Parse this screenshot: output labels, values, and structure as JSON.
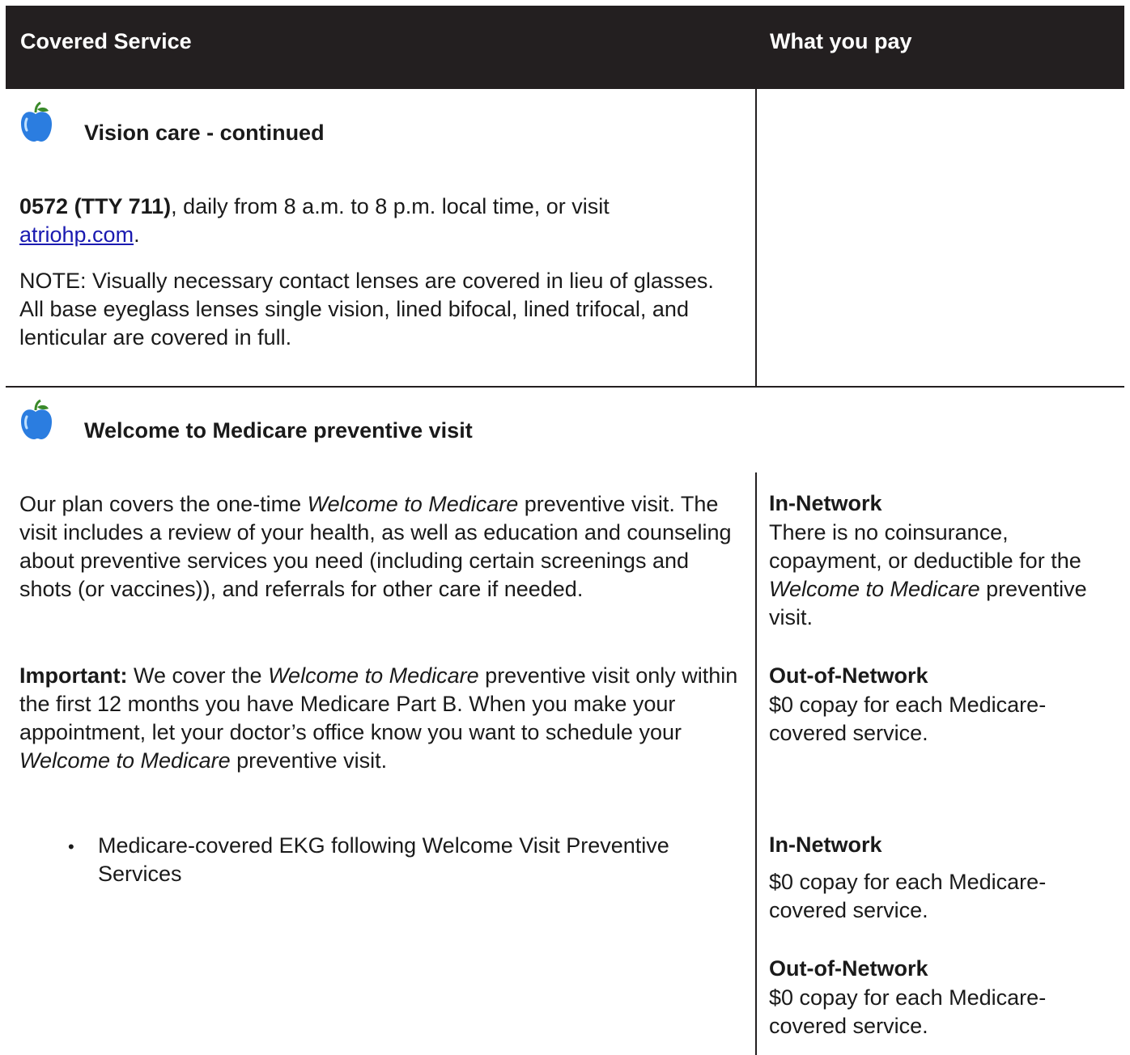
{
  "header": {
    "col_service": "Covered Service",
    "col_pay": "What you pay"
  },
  "section1": {
    "title": "Vision care - continued",
    "phone_bold": "0572 (TTY 711)",
    "phone_rest": ", daily from 8 a.m. to 8 p.m. local time, or visit",
    "link_text": "atriohp.com",
    "link_suffix": ".",
    "note": "NOTE:  Visually necessary contact lenses are covered in lieu of glasses. All base eyeglass lenses single vision, lined bifocal, lined trifocal, and lenticular are covered in full."
  },
  "section2": {
    "title": "Welcome to Medicare preventive visit",
    "p1_a": "Our plan covers the one-time ",
    "p1_italic": "Welcome to Medicare",
    "p1_b": " preventive visit. The visit includes a review of your health, as well as education and counseling about preventive services you need (including certain screenings and shots (or vaccines)), and referrals for other care if needed.",
    "p2_label": "Important:",
    "p2_a": " We cover the ",
    "p2_italic1": "Welcome to Medicare",
    "p2_b": " preventive visit only within the first 12 months you have Medicare Part B. When you make your appointment, let your doctor’s office know you want to schedule your ",
    "p2_italic2": "Welcome to Medicare",
    "p2_c": " preventive visit.",
    "bullet": "Medicare-covered EKG following Welcome Visit Preventive Services",
    "pay": {
      "in_network_1": "In-Network",
      "in_text_1a": "There is no coinsurance, copayment, or deductible for the ",
      "in_text_1_italic": "Welcome to Medicare",
      "in_text_1b": " preventive visit.",
      "out_network_1": "Out-of-Network",
      "out_text_1": "$0 copay for each Medicare-covered service.",
      "in_network_2": "In-Network",
      "in_text_2": "$0 copay for each Medicare-covered service.",
      "out_network_2": "Out-of-Network",
      "out_text_2": "$0 copay for each Medicare-covered service."
    }
  },
  "icons": {
    "apple_color": "#2b7de0",
    "leaf_color": "#3a8a2a"
  }
}
